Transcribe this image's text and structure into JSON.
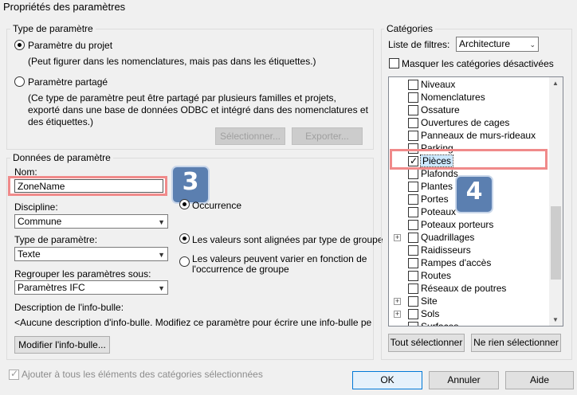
{
  "window": {
    "title": "Propriétés des paramètres"
  },
  "param_type": {
    "label": "Type de paramètre",
    "project_param": "Paramètre du projet",
    "project_desc": "(Peut figurer dans les nomenclatures, mais pas dans les étiquettes.)",
    "shared_param": "Paramètre partagé",
    "shared_desc_1": "(Ce type de paramètre peut être partagé par plusieurs familles et projets,",
    "shared_desc_2": "exporté dans une base de données ODBC et intégré dans des nomenclatures et",
    "shared_desc_3": "des étiquettes.)",
    "select_btn": "Sélectionner...",
    "export_btn": "Exporter..."
  },
  "param_data": {
    "label": "Données de paramètre",
    "name_label": "Nom:",
    "name_value": "ZoneName",
    "discipline_label": "Discipline:",
    "discipline_value": "Commune",
    "type_label": "Type de paramètre:",
    "type_value": "Texte",
    "group_label": "Regrouper les paramètres sous:",
    "group_value": "Paramètres IFC",
    "occurrence": "Occurrence",
    "aligned": "Les valeurs sont alignées par type de groupe",
    "vary_1": "Les valeurs peuvent varier en fonction de",
    "vary_2": "l'occurrence de groupe",
    "tooltip_label": "Description de l'info-bulle:",
    "tooltip_value": "<Aucune description d'info-bulle. Modifiez ce paramètre pour écrire une info-bulle personna...",
    "edit_tooltip_btn": "Modifier l'info-bulle..."
  },
  "categories": {
    "label": "Catégories",
    "filter_label": "Liste de filtres:",
    "filter_value": "Architecture",
    "hide_disabled": "Masquer les catégories désactivées",
    "items": [
      {
        "label": "Niveaux",
        "checked": false,
        "expand": false
      },
      {
        "label": "Nomenclatures",
        "checked": false,
        "expand": false
      },
      {
        "label": "Ossature",
        "checked": false,
        "expand": false
      },
      {
        "label": "Ouvertures de cages",
        "checked": false,
        "expand": false
      },
      {
        "label": "Panneaux de murs-rideaux",
        "checked": false,
        "expand": false
      },
      {
        "label": "Parking",
        "checked": false,
        "expand": false
      },
      {
        "label": "Pièces",
        "checked": true,
        "expand": false
      },
      {
        "label": "Plafonds",
        "checked": false,
        "expand": false
      },
      {
        "label": "Plantes",
        "checked": false,
        "expand": false
      },
      {
        "label": "Portes",
        "checked": false,
        "expand": false
      },
      {
        "label": "Poteaux",
        "checked": false,
        "expand": false
      },
      {
        "label": "Poteaux porteurs",
        "checked": false,
        "expand": false
      },
      {
        "label": "Quadrillages",
        "checked": false,
        "expand": true
      },
      {
        "label": "Raidisseurs",
        "checked": false,
        "expand": false
      },
      {
        "label": "Rampes d'accès",
        "checked": false,
        "expand": false
      },
      {
        "label": "Routes",
        "checked": false,
        "expand": false
      },
      {
        "label": "Réseaux de poutres",
        "checked": false,
        "expand": false
      },
      {
        "label": "Site",
        "checked": false,
        "expand": true
      },
      {
        "label": "Sols",
        "checked": false,
        "expand": true
      },
      {
        "label": "Surfaces",
        "checked": false,
        "expand": false
      }
    ],
    "select_all_btn": "Tout sélectionner",
    "select_none_btn": "Ne rien sélectionner"
  },
  "footer": {
    "add_all": "Ajouter à tous les éléments des catégories sélectionnées",
    "ok_btn": "OK",
    "cancel_btn": "Annuler",
    "help_btn": "Aide"
  },
  "annotations": {
    "badge_name": "3",
    "badge_list": "4"
  },
  "colors": {
    "highlight": "#f08a8a",
    "badge": "#5b7fb0",
    "selection": "#cce8ff"
  }
}
